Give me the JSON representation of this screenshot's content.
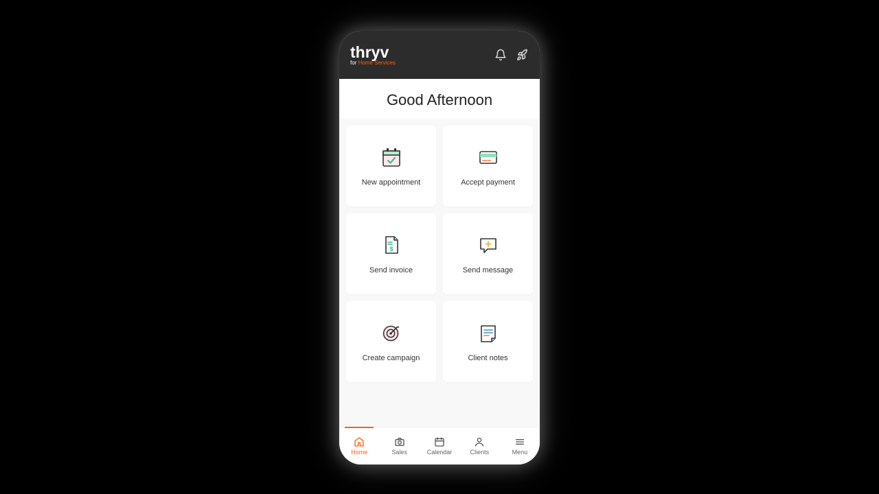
{
  "brand": {
    "name": "thryv",
    "tagline_prefix": "for ",
    "tagline_accent": "Home Services"
  },
  "greeting": "Good Afternoon",
  "cards": {
    "new_appointment": "New appointment",
    "accept_payment": "Accept payment",
    "send_invoice": "Send invoice",
    "send_message": "Send message",
    "create_campaign": "Create campaign",
    "client_notes": "Client notes"
  },
  "tabs": {
    "home": "Home",
    "sales": "Sales",
    "calendar": "Calendar",
    "clients": "Clients",
    "menu": "Menu"
  },
  "colors": {
    "accent": "#ff5e13",
    "header_bg": "#2c2c2c"
  }
}
